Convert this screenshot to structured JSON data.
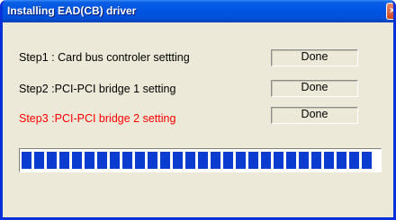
{
  "window": {
    "title": "Installing EAD(CB) driver",
    "close_glyph": "×"
  },
  "steps": [
    {
      "label": "Step1 : Card bus controler settting",
      "status": "Done",
      "color": "#000000"
    },
    {
      "label": "Step2 :PCI-PCI bridge 1 setting",
      "status": "Done",
      "color": "#000000"
    },
    {
      "label": "Step3 :PCI-PCI bridge 2 setting",
      "status": "Done",
      "color": "#ff0000"
    }
  ],
  "progress": {
    "fraction": 1.0,
    "block_color": "#0a3cd0"
  },
  "colors": {
    "titlebar": "#0054e3",
    "active_step": "#ff0000",
    "dialog_background": "#ece9d8"
  }
}
